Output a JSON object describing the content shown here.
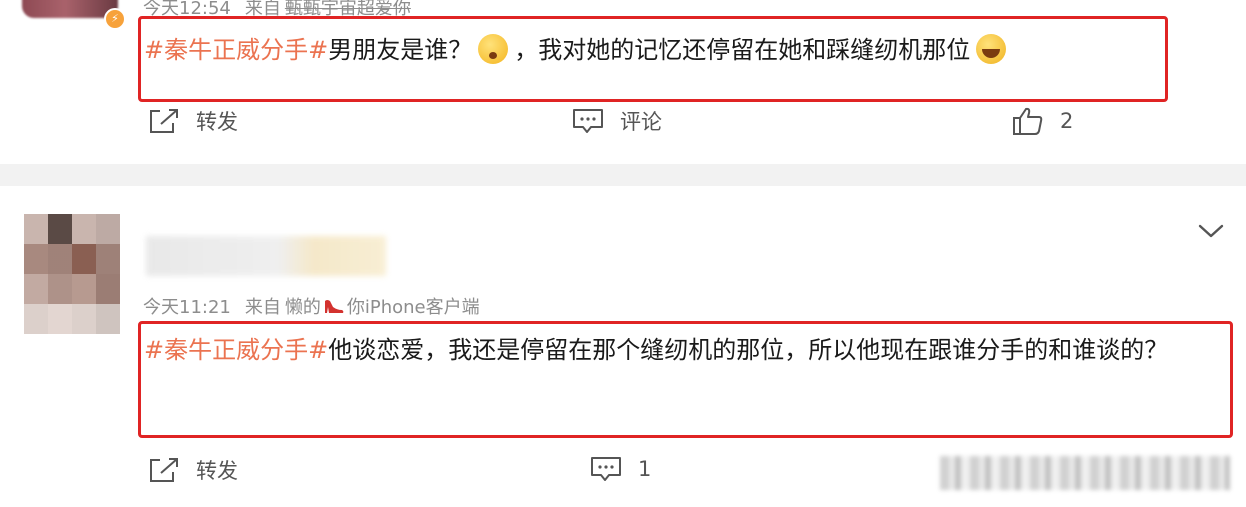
{
  "posts": [
    {
      "time": "今天12:54",
      "source_prefix": "来自",
      "source_name": "甄甄宇宙超爱你",
      "topic": "#秦牛正威分手#",
      "text_part1": "男朋友是谁？",
      "text_part2": "，我对她的记忆还停留在她和踩缝纫机那位",
      "repost_label": "转发",
      "comment_label": "评论",
      "like_count": "2"
    },
    {
      "time": "今天11:21",
      "source_prefix": "来自",
      "source_name_a": "懒的",
      "source_name_b": "你iPhone客户端",
      "topic": "#秦牛正威分手#",
      "text": "他谈恋爱，我还是停留在那个缝纫机的那位，所以他现在跟谁分手的和谁谈的？",
      "repost_label": "转发",
      "comment_count": "1"
    }
  ],
  "icons": {
    "repost": "repost-icon",
    "comment": "comment-icon",
    "like": "thumbs-up-icon",
    "expand": "chevron-down-icon",
    "emoji1": "shocked-face-emoji",
    "emoji2": "laughing-crying-emoji",
    "shoe": "red-high-heel-icon",
    "badge": "verified-badge-icon"
  },
  "colors": {
    "topic": "#eb7350",
    "highlight_box": "#e02424",
    "meta_text": "#8d8d8d",
    "separator": "#f2f2f2"
  }
}
